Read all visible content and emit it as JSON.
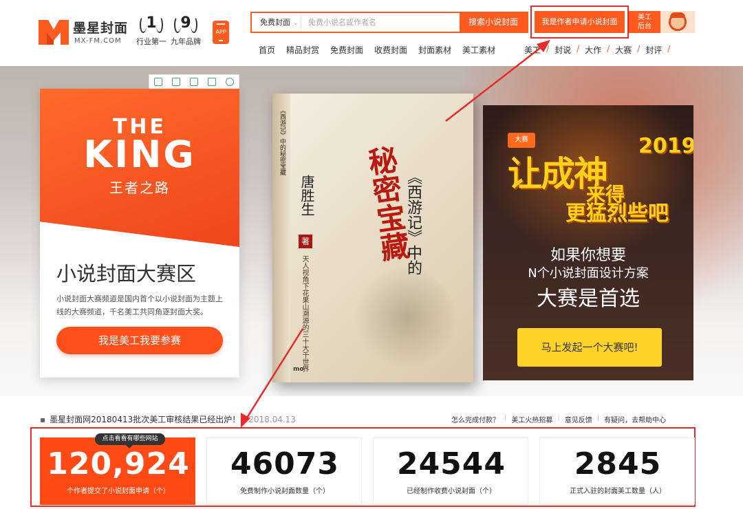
{
  "header": {
    "logo": {
      "name": "墨星封面",
      "url": "MX-FM.COM"
    },
    "badges": [
      {
        "num": "1",
        "text": "行业第一"
      },
      {
        "num": "9",
        "text": "九年品牌"
      }
    ],
    "app_label": "APP",
    "search": {
      "type_label": "免费封面",
      "placeholder": "免费小说名或作者名",
      "button": "搜索小说封面"
    },
    "apply_button": "我是作者申请小说封面",
    "admin_button_line1": "美工",
    "admin_button_line2": "后台",
    "nav": [
      "首页",
      "精品封赏",
      "免费封面",
      "收费封面",
      "封面素材",
      "美工素材"
    ],
    "nav_sub": [
      "美工",
      "封说",
      "大作",
      "大赛",
      "封评"
    ]
  },
  "hero": {
    "left_panel": {
      "the": "THE",
      "king": "KING",
      "subtitle": "王者之路",
      "title": "小说封面大赛区",
      "description": "小说封面大赛频道是国内首个以小说封面为主题上线的大赛频道，千名美工共同角逐封面大奖。",
      "button": "我是美工我要参赛"
    },
    "book": {
      "red_title": "秘密宝藏",
      "title": "《西游记》中的",
      "author": "唐胜生",
      "seal": "著",
      "side_text": "《西游记》中的秘密宝藏",
      "small_text": "天人视角下花果山溯源的三十大千世界",
      "publisher": "mo"
    },
    "right_panel": {
      "tag": "大赛",
      "slogan_main": "让成神",
      "slogan_come": "来得",
      "year": "2019",
      "slogan_more": "更猛烈些吧",
      "line1": "如果你想要",
      "line2": "N个小说封面设计方案",
      "line3": "大赛是首选",
      "button": "马上发起一个大赛吧!"
    }
  },
  "notice": {
    "text": "墨星封面网20180413批次美工审核结果已经出炉！",
    "date": "2018.04.13"
  },
  "quick_links": [
    "怎么完成付款？",
    "美工火热招募",
    "意见反馈",
    "有疑问，去帮助中心"
  ],
  "stats": {
    "tooltip": "点击看看有哪些网站",
    "items": [
      {
        "value": "120,924",
        "label": "个作者提交了小说封面申请（个）"
      },
      {
        "value": "46073",
        "label": "免费制作小说封面数量（个）"
      },
      {
        "value": "24544",
        "label": "已经制作收费小说封面（个）"
      },
      {
        "value": "2845",
        "label": "正式入驻的封面美工数量（人）"
      }
    ]
  },
  "colors": {
    "brand_orange": "#ff5a1f",
    "annotation_red": "#e82a2a",
    "cta_yellow": "#ffd328"
  },
  "icons": [
    "logo-mark-icon",
    "app-phone-icon",
    "chevron-down-icon",
    "avatar-icon",
    "toolbar-icons"
  ]
}
